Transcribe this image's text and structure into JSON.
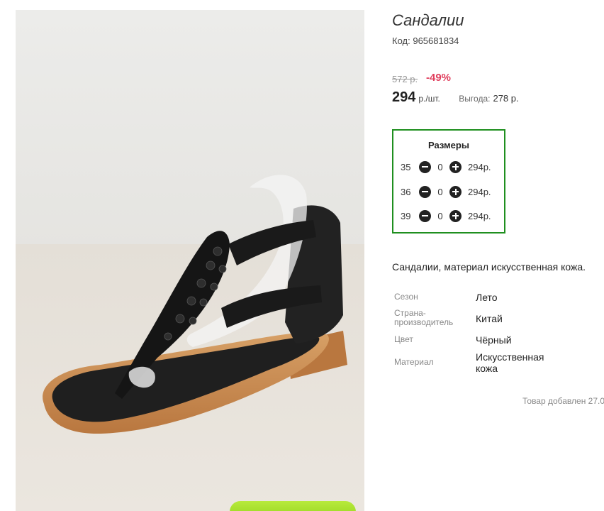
{
  "product": {
    "title": "Сандалии",
    "code_label": "Код:",
    "code": "965681834",
    "old_price": "572 р.",
    "discount": "-49%",
    "price": "294",
    "unit": "р./шт.",
    "savings_label": "Выгода:",
    "savings": "278 р."
  },
  "sizes": {
    "title": "Размеры",
    "rows": [
      {
        "size": "35",
        "qty": "0",
        "price": "294р."
      },
      {
        "size": "36",
        "qty": "0",
        "price": "294р."
      },
      {
        "size": "39",
        "qty": "0",
        "price": "294р."
      }
    ]
  },
  "description": "Сандалии, материал искусственная кожа.",
  "specs": [
    {
      "label": "Сезон",
      "value": "Лето"
    },
    {
      "label": "Страна-производитель",
      "value": "Китай"
    },
    {
      "label": "Цвет",
      "value": "Чёрный"
    },
    {
      "label": "Материал",
      "value": "Искусственная кожа"
    }
  ],
  "added_note": "Товар добавлен 27.0",
  "colors": {
    "accent_green": "#1f8f1f",
    "discount_red": "#e0405e",
    "cart_button": "#8fd01a"
  },
  "icons": [
    "minus-icon",
    "plus-icon"
  ]
}
